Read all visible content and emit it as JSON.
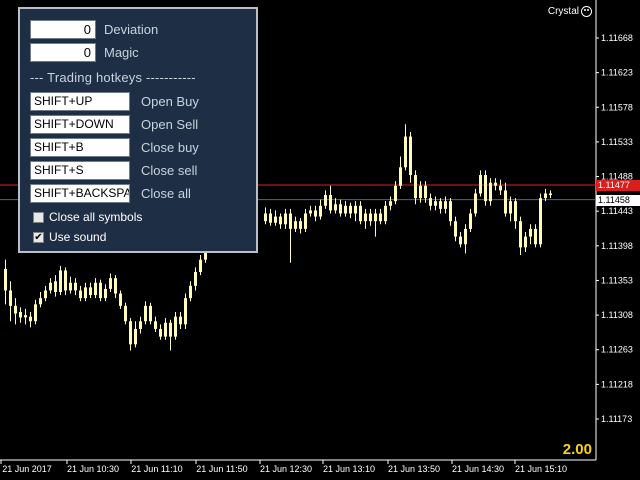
{
  "panel": {
    "deviation_value": "0",
    "deviation_label": "Deviation",
    "magic_value": "0",
    "magic_label": "Magic",
    "section_title": "--- Trading hotkeys -----------",
    "hotkeys": [
      {
        "key": "SHIFT+UP",
        "action": "Open Buy"
      },
      {
        "key": "SHIFT+DOWN",
        "action": "Open Sell"
      },
      {
        "key": "SHIFT+B",
        "action": "Close buy"
      },
      {
        "key": "SHIFT+S",
        "action": "Close sell"
      },
      {
        "key": "SHIFT+BACKSPA",
        "action": "Close all"
      }
    ],
    "close_all_symbols_label": "Close all symbols",
    "close_all_symbols_checked": false,
    "use_sound_label": "Use sound",
    "use_sound_checked": true
  },
  "indicator_name": "Crystal",
  "scale_value": "2.00",
  "colors": {
    "background": "#000000",
    "candle": "#fffbb8",
    "grid": "#2a3a5a",
    "ask_line": "#d81f1f",
    "bid_line": "#556677",
    "panel_bg": "#1e2f45"
  },
  "chart_data": {
    "type": "candlestick",
    "price_axis": [
      "1.11668",
      "1.11623",
      "1.11578",
      "1.11533",
      "1.11488",
      "1.11443",
      "1.11398",
      "1.11353",
      "1.11308",
      "1.11263",
      "1.11218",
      "1.11173"
    ],
    "time_axis": [
      "21 Jun 2017",
      "21 Jun 10:30",
      "21 Jun 11:10",
      "21 Jun 11:50",
      "21 Jun 12:30",
      "21 Jun 13:10",
      "21 Jun 13:50",
      "21 Jun 14:30",
      "21 Jun 15:10"
    ],
    "ask_price": "1.11477",
    "bid_price": "1.11458",
    "ylim": [
      1.1115,
      1.117
    ]
  }
}
